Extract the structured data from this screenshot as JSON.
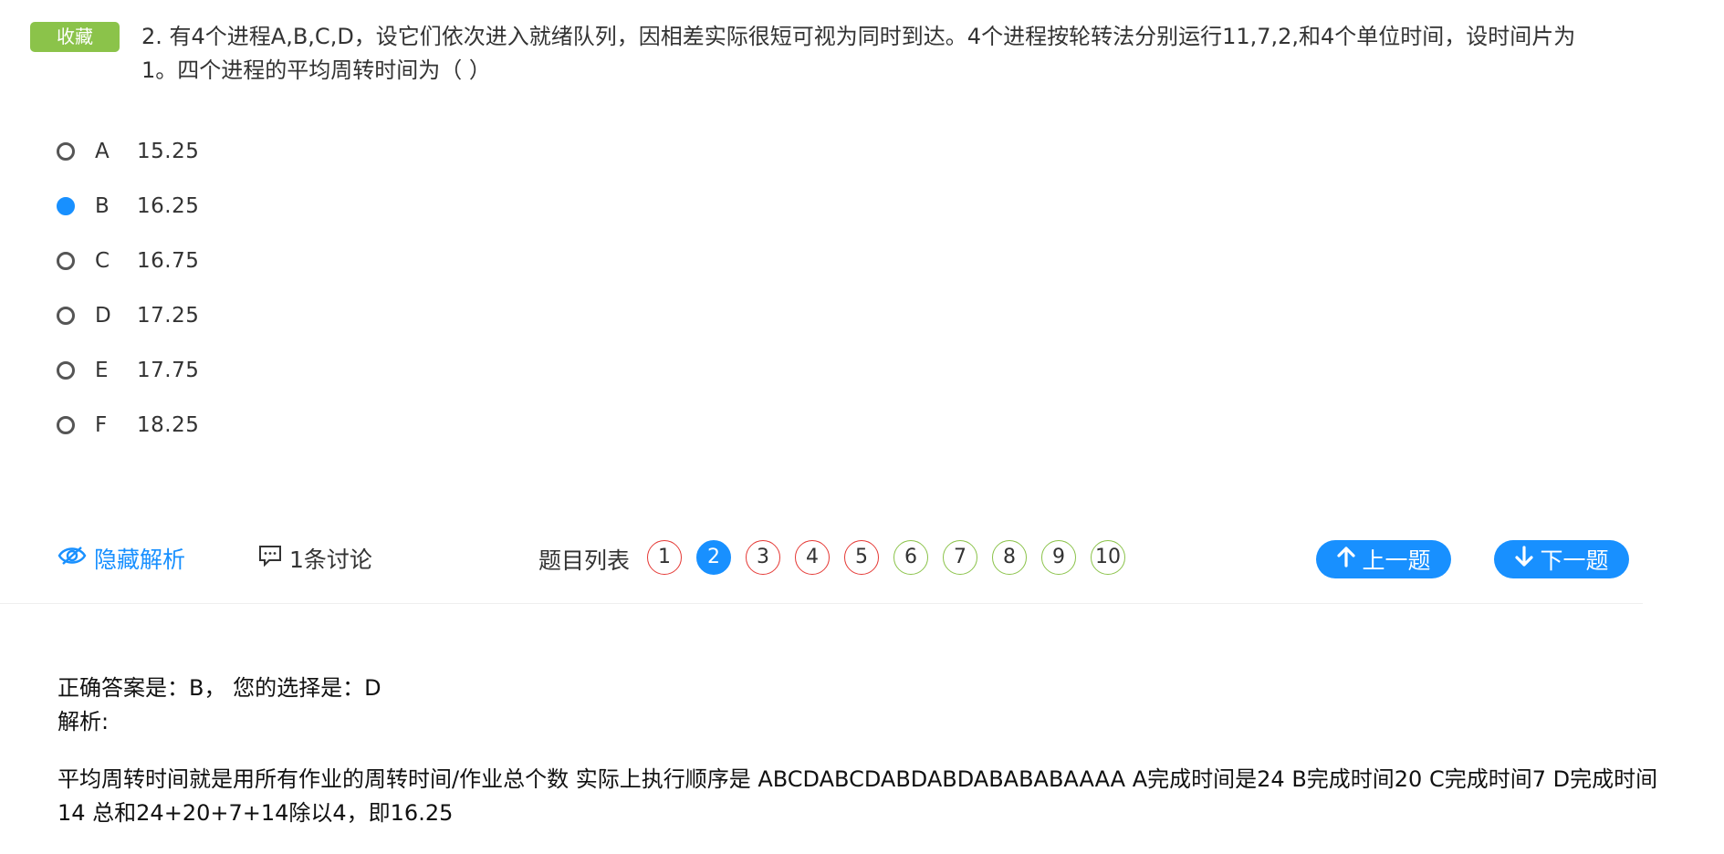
{
  "fav_label": "收藏",
  "question": "2. 有4个进程A,B,C,D，设它们依次进入就绪队列，因相差实际很短可视为同时到达。4个进程按轮转法分别运行11,7,2,和4个单位时间，设时间片为1。四个进程的平均周转时间为（ ）",
  "options": [
    {
      "letter": "A",
      "text": "15.25",
      "selected": false
    },
    {
      "letter": "B",
      "text": "16.25",
      "selected": true
    },
    {
      "letter": "C",
      "text": "16.75",
      "selected": false
    },
    {
      "letter": "D",
      "text": "17.25",
      "selected": false
    },
    {
      "letter": "E",
      "text": "17.75",
      "selected": false
    },
    {
      "letter": "F",
      "text": "18.25",
      "selected": false
    }
  ],
  "toolbar": {
    "hide_analysis": "隐藏解析",
    "discuss": "1条讨论",
    "question_list_label": "题目列表",
    "question_numbers": [
      {
        "num": "1",
        "status": "wrong"
      },
      {
        "num": "2",
        "status": "current"
      },
      {
        "num": "3",
        "status": "wrong"
      },
      {
        "num": "4",
        "status": "wrong"
      },
      {
        "num": "5",
        "status": "wrong"
      },
      {
        "num": "6",
        "status": "correct"
      },
      {
        "num": "7",
        "status": "correct"
      },
      {
        "num": "8",
        "status": "correct"
      },
      {
        "num": "9",
        "status": "correct"
      },
      {
        "num": "10",
        "status": "correct"
      }
    ],
    "prev_label": "上一题",
    "next_label": "下一题"
  },
  "answer": {
    "line": "正确答案是：B， 您的选择是：D",
    "analysis_label": "解析:",
    "analysis_text": "平均周转时间就是用所有作业的周转时间/作业总个数 实际上执行顺序是 ABCDABCDABDABDABABABAAAA A完成时间是24 B完成时间20 C完成时间7 D完成时间14 总和24+20+7+14除以4，即16.25"
  },
  "colors": {
    "accent": "#1890ff",
    "fav_green": "#8bc34a",
    "wrong_red": "#e53935",
    "correct_green": "#8bc34a"
  }
}
